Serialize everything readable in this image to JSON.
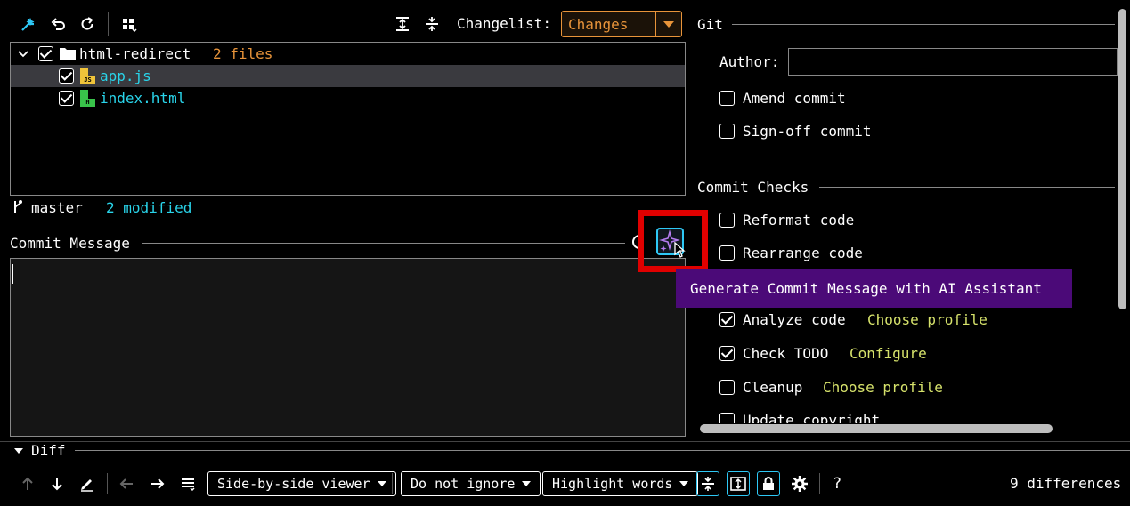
{
  "toolbar": {
    "changelist_label": "Changelist:",
    "changelist_value": "Changes"
  },
  "tree": {
    "root_name": "html-redirect",
    "root_count": "2 files",
    "files": [
      {
        "name": "app.js",
        "type": "JS",
        "color": "#29d4ea"
      },
      {
        "name": "index.html",
        "type": "H",
        "color": "#29d4ea"
      }
    ]
  },
  "branch": {
    "name": "master",
    "status": "2 modified"
  },
  "commit": {
    "label": "Commit Message",
    "text": ""
  },
  "tooltip": "Generate Commit Message with AI Assistant",
  "git": {
    "title": "Git",
    "author_label": "Author:",
    "author_value": "",
    "amend": {
      "label": "Amend commit",
      "checked": false
    },
    "signoff": {
      "label": "Sign-off commit",
      "checked": false
    }
  },
  "checks": {
    "title": "Commit Checks",
    "reformat": {
      "label": "Reformat code",
      "checked": false
    },
    "rearrange": {
      "label": "Rearrange code",
      "checked": false
    },
    "analyze": {
      "label": "Analyze code",
      "checked": true,
      "link": "Choose profile"
    },
    "todo": {
      "label": "Check TODO",
      "checked": true,
      "link": "Configure"
    },
    "cleanup": {
      "label": "Cleanup",
      "checked": false,
      "link": "Choose profile"
    },
    "copyright": {
      "label": "Update copyright",
      "checked": false
    }
  },
  "diff": {
    "label": "Diff",
    "viewer": "Side-by-side viewer",
    "ignore": "Do not ignore",
    "highlight": "Highlight words",
    "differences": "9 differences",
    "help": "?"
  },
  "colors": {
    "accent": "#2ec8f5",
    "orange": "#e8943a",
    "link": "#d6e26b",
    "tooltip_bg": "#4b0a78",
    "highlight_red": "#e00000"
  }
}
